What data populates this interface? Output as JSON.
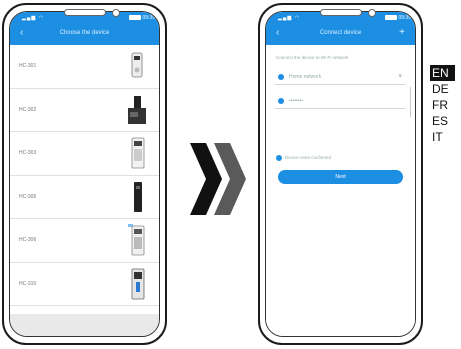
{
  "left_phone": {
    "status_time": "09:39",
    "title": "Choose the device",
    "devices": [
      {
        "label": "HC-301",
        "icon": "doorbell-icon"
      },
      {
        "label": "HC-302",
        "icon": "camera-mount-icon"
      },
      {
        "label": "HC-303",
        "icon": "intercom-panel-icon"
      },
      {
        "label": "HC-305",
        "icon": "slim-doorbell-icon"
      },
      {
        "label": "HC-306",
        "icon": "intercom-panel-icon"
      },
      {
        "label": "HC-310",
        "icon": "video-doorbell-icon"
      }
    ]
  },
  "right_phone": {
    "status_time": "09:39",
    "title": "Connect device",
    "hint": "Connect the device to Wi-Fi network",
    "field_network": "Home network",
    "field_password": "••••••••",
    "check_label": "Device reset confirmed",
    "next_label": "Next"
  },
  "languages": [
    "EN",
    "DE",
    "FR",
    "ES",
    "IT"
  ],
  "active_language": "EN",
  "colors": {
    "accent": "#1c8fe3",
    "arrow_dark": "#111111",
    "arrow_gray": "#5a5a5a"
  }
}
